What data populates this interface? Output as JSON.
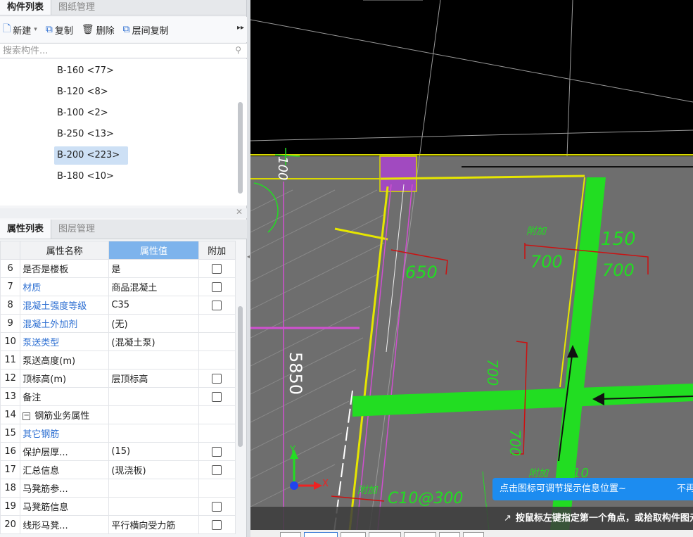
{
  "component_panel": {
    "tabs": [
      "构件列表",
      "图纸管理"
    ],
    "toolbar": {
      "new_label": "新建",
      "copy_label": "复制",
      "delete_label": "删除",
      "floor_copy_label": "层间复制"
    },
    "search_placeholder": "搜索构件...",
    "items": [
      "B-160 <77>",
      "B-120 <8>",
      "B-100 <2>",
      "B-250 <13>",
      "B-200 <223>",
      "B-180 <10>"
    ],
    "selected_index": 4
  },
  "property_panel": {
    "tabs": [
      "属性列表",
      "图层管理"
    ],
    "headers": [
      "属性名称",
      "属性值",
      "附加"
    ],
    "rows": [
      {
        "num": "6",
        "name": "是否是楼板",
        "value": "是"
      },
      {
        "num": "7",
        "name": "材质",
        "value": "商品混凝土"
      },
      {
        "num": "8",
        "name": "混凝土强度等级",
        "value": "C35"
      },
      {
        "num": "9",
        "name": "混凝土外加剂",
        "value": "(无)"
      },
      {
        "num": "10",
        "name": "泵送类型",
        "value": "(混凝土泵)"
      },
      {
        "num": "11",
        "name": "泵送高度(m)",
        "value": ""
      },
      {
        "num": "12",
        "name": "顶标高(m)",
        "value": "层顶标高"
      },
      {
        "num": "13",
        "name": "备注",
        "value": ""
      },
      {
        "num": "14",
        "name": "钢筋业务属性",
        "value": ""
      },
      {
        "num": "15",
        "name": "其它钢筋",
        "value": ""
      },
      {
        "num": "16",
        "name": "保护层厚...",
        "value": "(15)"
      },
      {
        "num": "17",
        "name": "汇总信息",
        "value": "(现浇板)"
      },
      {
        "num": "18",
        "name": "马凳筋参...",
        "value": ""
      },
      {
        "num": "19",
        "name": "马凳筋信息",
        "value": ""
      },
      {
        "num": "20",
        "name": "线形马凳...",
        "value": "平行横向受力筋"
      }
    ]
  },
  "canvas": {
    "dims": {
      "d100": "100",
      "d650": "650",
      "d700a": "700",
      "d700b": "700",
      "d150": "150",
      "d700c": "700",
      "d700d": "700",
      "d5850": "5850",
      "d10": "10"
    },
    "labels": {
      "fujia1": "附加",
      "fujia2": "附加",
      "fujia3": "附加",
      "c10": "C10@300"
    },
    "axis_y": "Y",
    "axis_x": "X",
    "toast_text": "点击图标可调节提示信息位置~",
    "toast_skip": "不再",
    "status_text": "按鼠标左键指定第一个角点，或拾取构件图元"
  }
}
